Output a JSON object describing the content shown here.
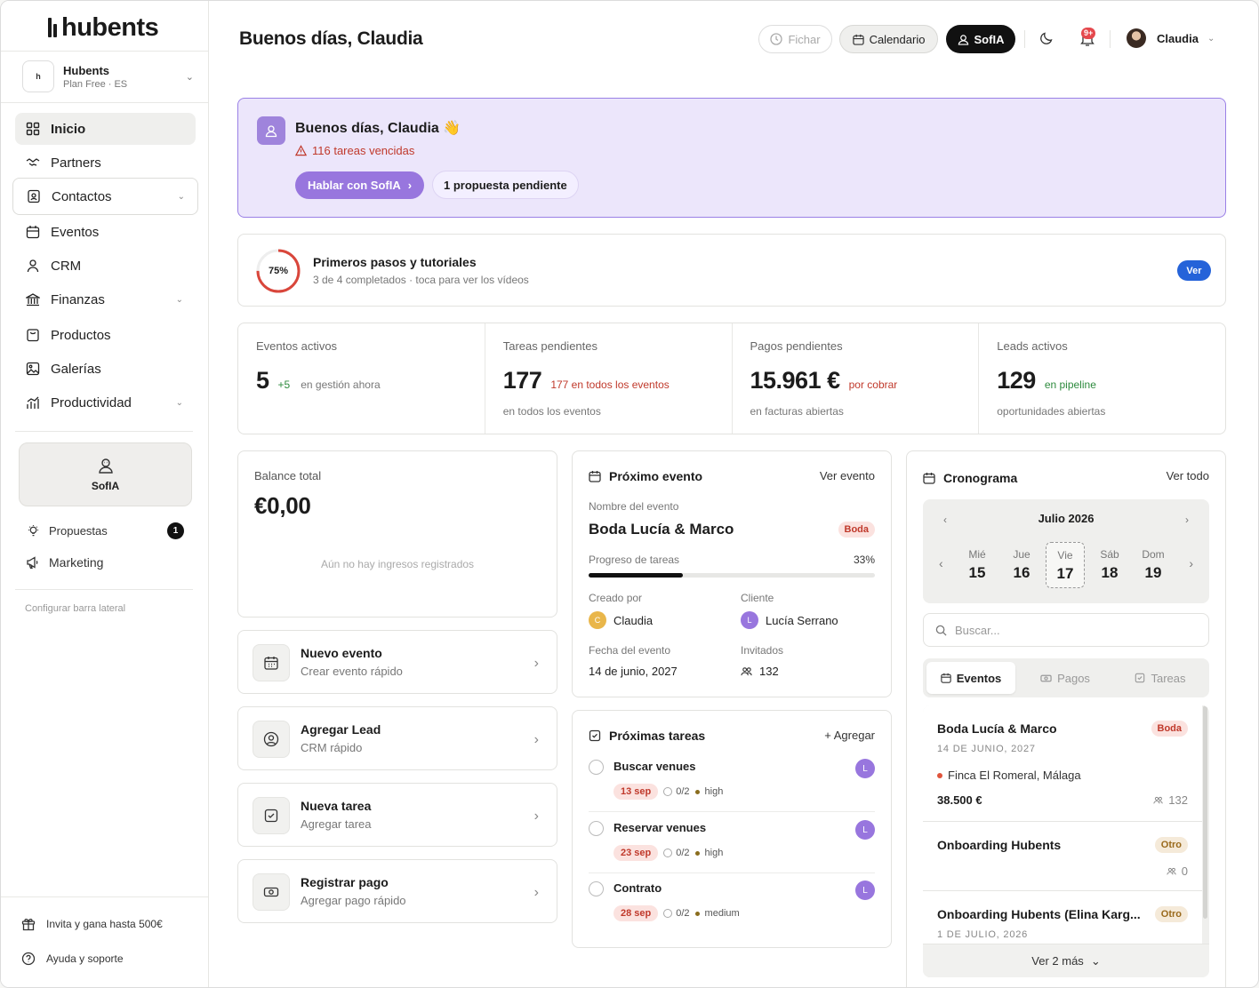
{
  "brand": {
    "name": "hubents"
  },
  "workspace": {
    "name": "Hubents",
    "plan": "Plan Free · ES",
    "logo_text": "h"
  },
  "sidebar": {
    "items": [
      {
        "label": "Inicio",
        "icon": "grid-icon"
      },
      {
        "label": "Partners",
        "icon": "handshake-icon"
      },
      {
        "label": "Contactos",
        "icon": "contact-icon"
      },
      {
        "label": "Eventos",
        "icon": "calendar-icon"
      },
      {
        "label": "CRM",
        "icon": "user-icon"
      },
      {
        "label": "Finanzas",
        "icon": "bank-icon"
      },
      {
        "label": "Productos",
        "icon": "bag-icon"
      },
      {
        "label": "Galerías",
        "icon": "image-icon"
      },
      {
        "label": "Productividad",
        "icon": "chart-icon"
      }
    ],
    "sofia_label": "SofIA",
    "propuestas_label": "Propuestas",
    "propuestas_count": "1",
    "marketing_label": "Marketing",
    "config_label": "Configurar barra lateral",
    "invite_label": "Invita y gana hasta 500€",
    "help_label": "Ayuda y soporte"
  },
  "header": {
    "title": "Buenos días, Claudia",
    "fichar": "FicHAR",
    "calendario": "Calendario",
    "sofia": "SofIA",
    "notif_count": "9+",
    "user": "Claudia"
  },
  "welcome": {
    "title": "Buenos días, Claudia 👋",
    "warning": "116 tareas vencidas",
    "cta": "Hablar con SofIA",
    "pending": "1 propuesta pendiente"
  },
  "steps": {
    "percent": "75%",
    "progress": 0.75,
    "title": "Primeros pasos y tutoriales",
    "subtitle": "3 de 4 completados · toca para ver los vídeos",
    "button": "Ver"
  },
  "stats": [
    {
      "label": "Eventos activos",
      "value": "5",
      "delta": "+5",
      "extra": "en gestión ahora",
      "sub": ""
    },
    {
      "label": "Tareas pendientes",
      "value": "177",
      "delta": "177 en todos los eventos",
      "extra": "",
      "sub": "en todos los eventos"
    },
    {
      "label": "Pagos pendientes",
      "value": "15.961 €",
      "delta": "por cobrar",
      "extra": "",
      "sub": "en facturas abiertas"
    },
    {
      "label": "Leads activos",
      "value": "129",
      "delta": "en pipeline",
      "extra": "",
      "sub": "oportunidades abiertas"
    }
  ],
  "balance": {
    "title": "Balance total",
    "value": "€0,00",
    "empty": "Aún no hay ingresos registrados"
  },
  "quick_actions": [
    {
      "title": "Nuevo evento",
      "subtitle": "Crear evento rápido"
    },
    {
      "title": "Agregar Lead",
      "subtitle": "CRM rápido"
    },
    {
      "title": "Nueva tarea",
      "subtitle": "Agregar tarea"
    },
    {
      "title": "Registrar pago",
      "subtitle": "Agregar pago rápido"
    }
  ],
  "next_event": {
    "title": "Próximo evento",
    "link": "Ver evento",
    "name_label": "Nombre del evento",
    "name": "Boda Lucía & Marco",
    "type": "Boda",
    "progress_label": "Progreso de tareas",
    "progress_pct": "33%",
    "progress": 0.33,
    "created_label": "Creado por",
    "created_by": "Claudia",
    "created_initial": "C",
    "client_label": "Cliente",
    "client": "Lucía Serrano",
    "client_initial": "L",
    "date_label": "Fecha del evento",
    "date": "14 de junio, 2027",
    "guests_label": "Invitados",
    "guests": "132"
  },
  "tasks": {
    "title": "Próximas tareas",
    "add": "Agregar",
    "items": [
      {
        "name": "Buscar venues",
        "date": "13 sep",
        "count": "0/2",
        "priority": "high",
        "assignee": "L"
      },
      {
        "name": "Reservar venues",
        "date": "23 sep",
        "count": "0/2",
        "priority": "high",
        "assignee": "L"
      },
      {
        "name": "Contrato",
        "date": "28 sep",
        "count": "0/2",
        "priority": "medium",
        "assignee": "L"
      }
    ]
  },
  "schedule": {
    "title": "Cronograma",
    "link": "Ver todo",
    "month": "Julio 2026",
    "days": [
      {
        "n": "Mié",
        "d": "15"
      },
      {
        "n": "Jue",
        "d": "16"
      },
      {
        "n": "Vie",
        "d": "17"
      },
      {
        "n": "Sáb",
        "d": "18"
      },
      {
        "n": "Dom",
        "d": "19"
      }
    ],
    "search_placeholder": "Buscar...",
    "tabs": [
      "Eventos",
      "Pagos",
      "Tareas"
    ],
    "events": [
      {
        "title": "Boda Lucía & Marco",
        "type": "Boda",
        "date": "14 DE JUNIO, 2027",
        "place": "Finca El Romeral, Málaga",
        "amount": "38.500 €",
        "guests": "132"
      },
      {
        "title": "Onboarding Hubents",
        "type": "Otro",
        "guests": "0"
      },
      {
        "title": "Onboarding Hubents (Elina Karg...",
        "type": "Otro",
        "date": "1 DE JULIO, 2026"
      }
    ],
    "more": "Ver 2 más"
  }
}
